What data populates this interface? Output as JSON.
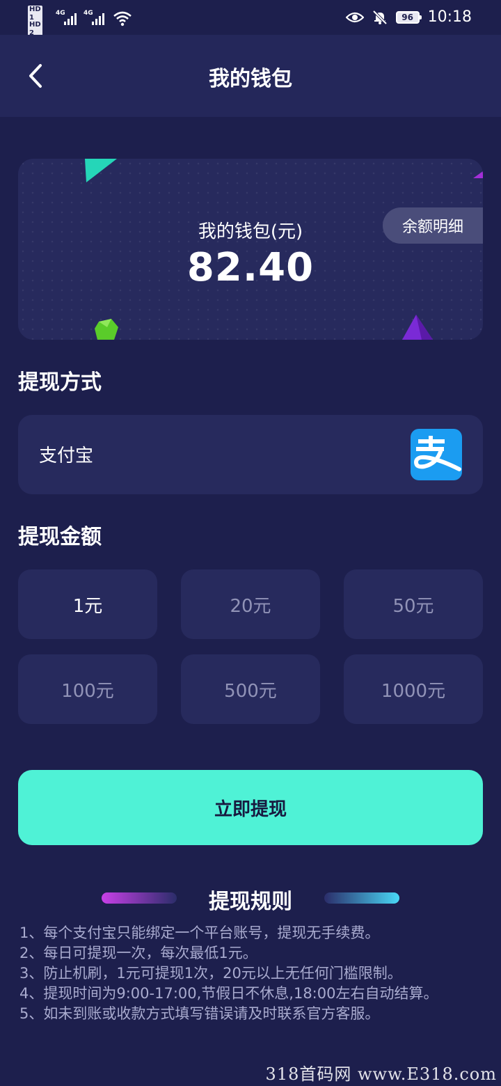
{
  "status_bar": {
    "sim1": "HD 1",
    "sim2": "HD 2",
    "net1": "4G",
    "net2": "4G",
    "battery": "96",
    "time": "10:18"
  },
  "header": {
    "title": "我的钱包"
  },
  "wallet": {
    "label": "我的钱包(元)",
    "balance": "82.40",
    "detail_button": "余额明细"
  },
  "withdraw_method": {
    "section_title": "提现方式",
    "method": "支付宝",
    "method_icon": "alipay-icon"
  },
  "withdraw_amount": {
    "section_title": "提现金额",
    "options": [
      "1元",
      "20元",
      "50元",
      "100元",
      "500元",
      "1000元"
    ],
    "selected_index": 0
  },
  "withdraw_button": "立即提现",
  "rules": {
    "title": "提现规则",
    "items": [
      "1、每个支付宝只能绑定一个平台账号，提现无手续费。",
      "2、每日可提现一次，每次最低1元。",
      "3、防止机刷，1元可提现1次，20元以上无任何门槛限制。",
      "4、提现时间为9:00-17:00,节假日不休息,18:00左右自动结算。",
      "5、如未到账或收款方式填写错误请及时联系官方客服。"
    ]
  },
  "watermark": "318首码网 www.E318.com",
  "colors": {
    "background": "#1d1f4d",
    "card": "#272a5d",
    "accent": "#4ff2d6",
    "alipay": "#1b9cf1"
  }
}
